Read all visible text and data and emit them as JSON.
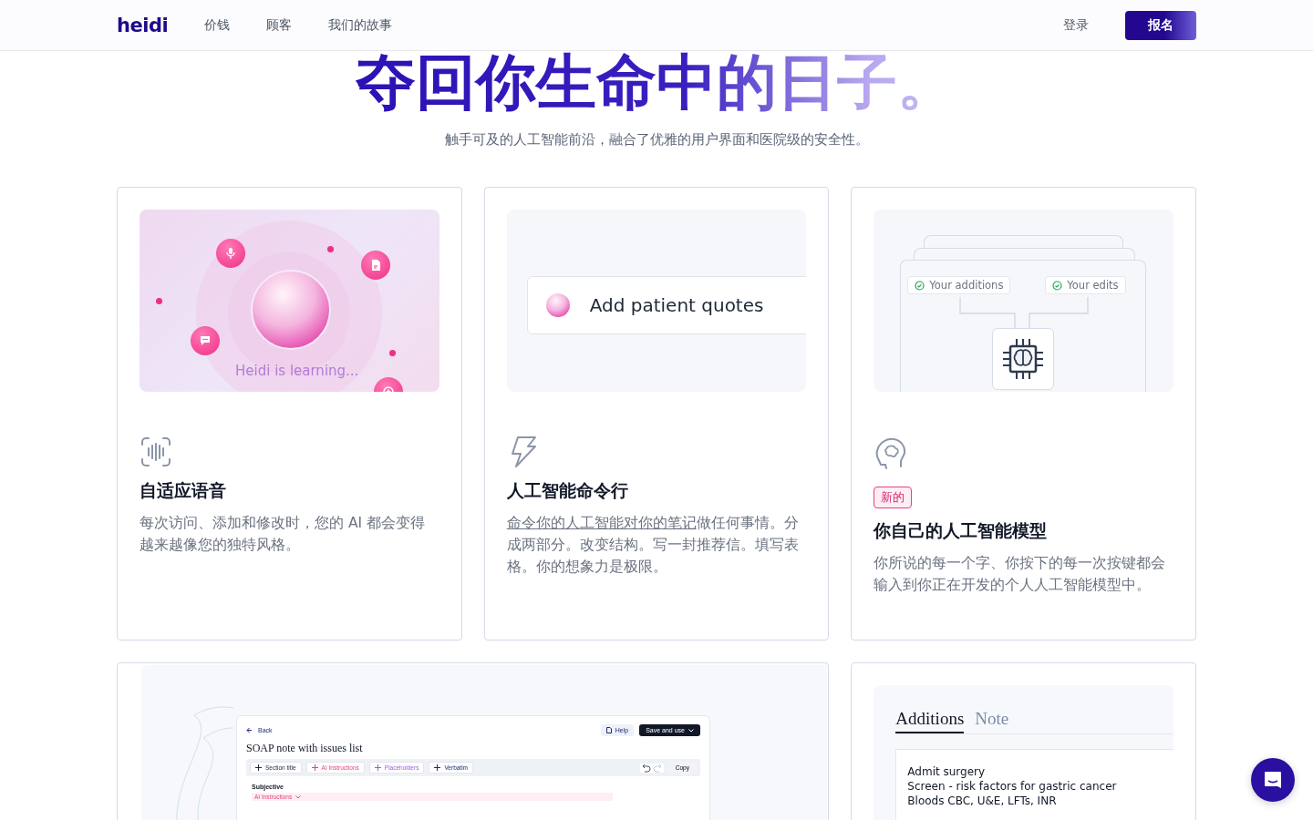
{
  "nav": {
    "logo": "heidi",
    "links": [
      "价钱",
      "顾客",
      "我们的故事"
    ],
    "login": "登录",
    "signup": "报名"
  },
  "hero": {
    "title": "夺回你生命中的日子。",
    "subtitle": "触手可及的人工智能前沿，融合了优雅的用户界面和医院级的安全性。"
  },
  "features": [
    {
      "kind": "learning",
      "caption": "Heidi is learning...",
      "title": "自适应语音",
      "description": "每次访问、添加和修改时，您的 AI 都会变得越来越像您的独特风格。"
    },
    {
      "kind": "command",
      "caption": "Add patient quotes",
      "title": "人工智能命令行",
      "description_link": "命令你的人工智能对你的笔记",
      "description": "做任何事情。分成两部分。改变结构。写一封推荐信。填写表格。你的想象力是极限。"
    },
    {
      "kind": "model",
      "chips": [
        "Your additions",
        "Your edits"
      ],
      "badge": "新的",
      "title": "你自己的人工智能模型",
      "description": "你所说的每一个字、你按下的每一次按键都会输入到你正在开发的个人人工智能模型中。"
    }
  ],
  "template_editor": {
    "back": "Back",
    "help": "Help",
    "save": "Save and use",
    "title": "SOAP note with issues list",
    "toolbar": [
      {
        "label": "Section title",
        "color": "#1f2937"
      },
      {
        "label": "AI Instructions",
        "color": "#e0457b"
      },
      {
        "label": "Placeholders",
        "color": "#9b5de5"
      },
      {
        "label": "Verbatim",
        "color": "#1e2a78"
      }
    ],
    "copy": "Copy",
    "section": "Subjective",
    "section_tag": "AI Instructions"
  },
  "note_panel": {
    "tabs": [
      {
        "label": "Additions",
        "selected": true
      },
      {
        "label": "Note",
        "selected": false
      }
    ],
    "lines": [
      "Admit surgery",
      "Screen - risk factors for gastric cancer",
      "Bloods CBC, U&E, LFTs, INR"
    ]
  }
}
